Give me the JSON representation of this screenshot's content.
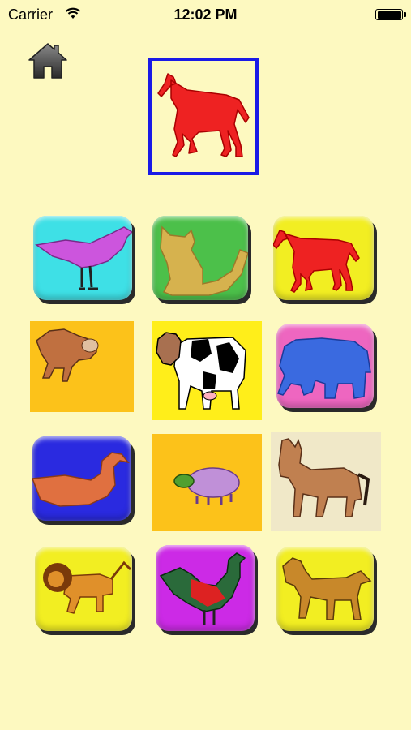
{
  "status_bar": {
    "carrier": "Carrier",
    "time": "12:02 PM"
  },
  "target": {
    "animal": "horse",
    "border_color": "#1a1ae6"
  },
  "tiles": [
    {
      "animal": "bird",
      "bg": "#3ee0e6"
    },
    {
      "animal": "cat",
      "bg": "#4cc04a"
    },
    {
      "animal": "horse",
      "bg": "#f2ee22"
    },
    {
      "animal": "monkey",
      "bg": "#fcc21a"
    },
    {
      "animal": "cow",
      "bg": "#ffee1a"
    },
    {
      "animal": "elephant",
      "bg": "#ee66c0"
    },
    {
      "animal": "duck",
      "bg": "#2a2ae0"
    },
    {
      "animal": "sheep",
      "bg": "#fcc21a"
    },
    {
      "animal": "donkey",
      "bg": "#f0e8c8"
    },
    {
      "animal": "lion",
      "bg": "#f2ee22"
    },
    {
      "animal": "rooster",
      "bg": "#cc2ae6"
    },
    {
      "animal": "dog",
      "bg": "#f2ee22"
    }
  ]
}
